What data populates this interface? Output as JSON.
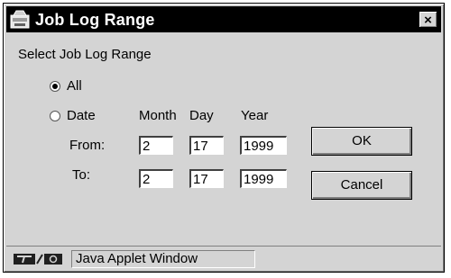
{
  "window": {
    "title": "Job Log Range",
    "title_icon": "applet-icon",
    "close_glyph": "×"
  },
  "dialog": {
    "heading": "Select Job Log Range",
    "range_options": [
      {
        "label": "All",
        "selected": true
      },
      {
        "label": "Date",
        "selected": false
      }
    ],
    "columns": {
      "month": "Month",
      "day": "Day",
      "year": "Year"
    },
    "from": {
      "label": "From:",
      "month": "2",
      "day": "17",
      "year": "1999"
    },
    "to": {
      "label": "To:",
      "month": "2",
      "day": "17",
      "year": "1999"
    },
    "ok_label": "OK",
    "cancel_label": "Cancel"
  },
  "statusbar": {
    "icon": "java-applet-icon",
    "text": "Java Applet Window"
  }
}
